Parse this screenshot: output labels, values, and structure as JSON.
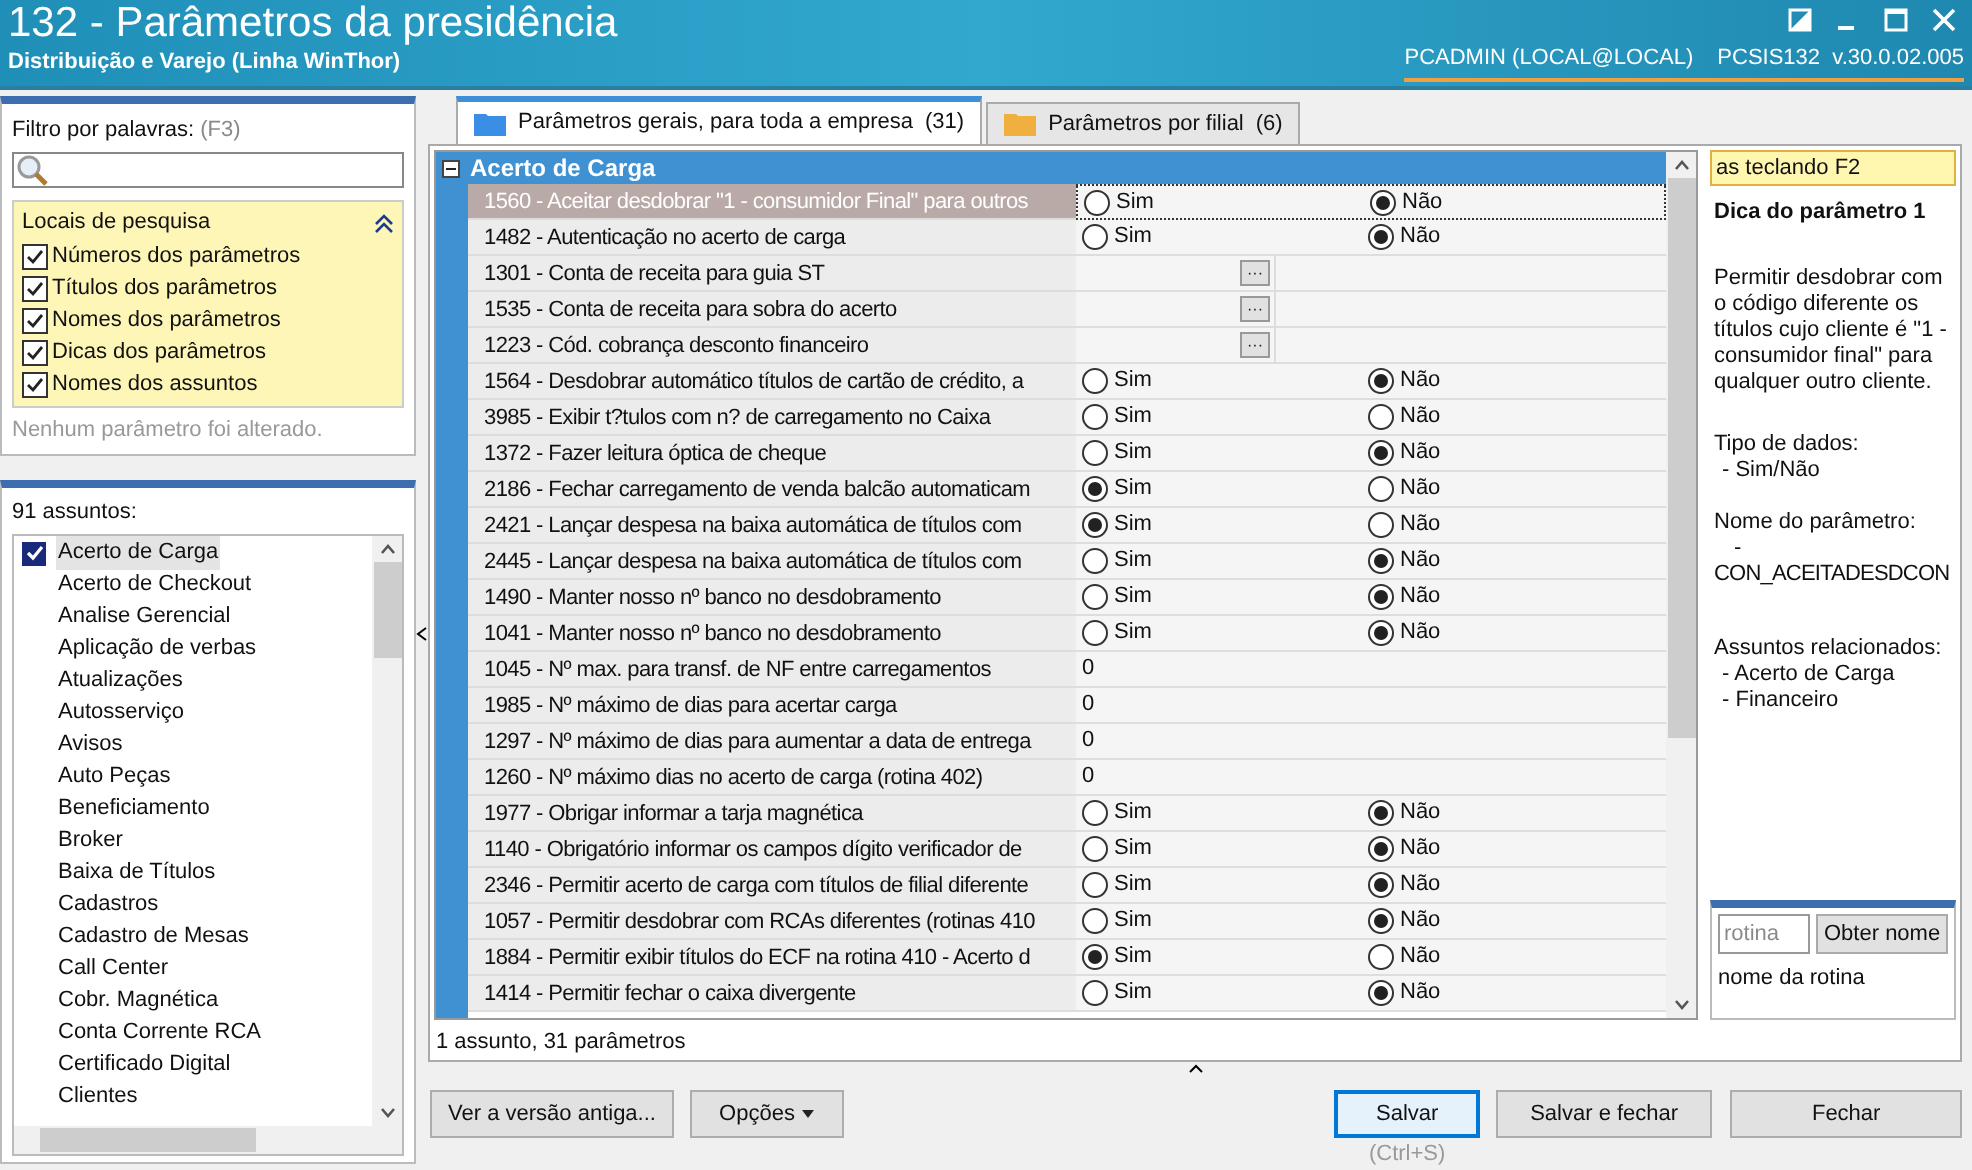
{
  "window": {
    "title": "132 - Parâmetros da presidência",
    "subtitle": "Distribuição e Varejo (Linha WinThor)",
    "user": "PCADMIN (LOCAL@LOCAL)",
    "version": "PCSIS132  v.30.0.02.005"
  },
  "filter": {
    "label": "Filtro por palavras:",
    "shortcut": "(F3)",
    "locations_title": "Locais de pesquisa",
    "locations": [
      {
        "label": "Números dos parâmetros",
        "checked": true
      },
      {
        "label": "Títulos dos parâmetros",
        "checked": true
      },
      {
        "label": "Nomes dos parâmetros",
        "checked": true
      },
      {
        "label": "Dicas dos parâmetros",
        "checked": true
      },
      {
        "label": "Nomes dos assuntos",
        "checked": true
      }
    ],
    "status": "Nenhum parâmetro foi alterado."
  },
  "subjects": {
    "count_label": "91 assuntos:",
    "items": [
      {
        "label": "Acerto de Carga",
        "checked": true
      },
      {
        "label": "Acerto de Checkout",
        "checked": false
      },
      {
        "label": "Analise Gerencial",
        "checked": false
      },
      {
        "label": "Aplicação de verbas",
        "checked": false
      },
      {
        "label": "Atualizações",
        "checked": false
      },
      {
        "label": "Autosserviço",
        "checked": false
      },
      {
        "label": "Avisos",
        "checked": false
      },
      {
        "label": "Auto Peças",
        "checked": false
      },
      {
        "label": "Beneficiamento",
        "checked": false
      },
      {
        "label": "Broker",
        "checked": false
      },
      {
        "label": "Baixa de Títulos",
        "checked": false
      },
      {
        "label": "Cadastros",
        "checked": false
      },
      {
        "label": "Cadastro de Mesas",
        "checked": false
      },
      {
        "label": "Call Center",
        "checked": false
      },
      {
        "label": "Cobr. Magnética",
        "checked": false
      },
      {
        "label": "Conta Corrente RCA",
        "checked": false
      },
      {
        "label": "Certificado Digital",
        "checked": false
      },
      {
        "label": "Clientes",
        "checked": false
      }
    ]
  },
  "tabs": [
    {
      "label": "Parâmetros gerais, para toda a empresa",
      "count": "(31)",
      "selected": true
    },
    {
      "label": "Parâmetros por filial",
      "count": "(6)",
      "selected": false
    }
  ],
  "group": {
    "title": "Acerto de Carga",
    "expanded": true
  },
  "parameters": [
    {
      "label": "1560 - Aceitar desdobrar \"1 - consumidor Final\" para outros",
      "kind": "yesno",
      "yes": "Sim",
      "no": "Não",
      "yes_selected": false,
      "no_selected": true,
      "selected": true
    },
    {
      "label": "1482 - Autenticação no acerto de carga",
      "kind": "yesno",
      "yes": "Sim",
      "no": "Não",
      "yes_selected": false,
      "no_selected": true,
      "selected": false
    },
    {
      "label": "1301 - Conta de receita para guia ST",
      "kind": "lookup",
      "button": "···",
      "selected": false
    },
    {
      "label": "1535 - Conta de receita para sobra do acerto",
      "kind": "lookup",
      "button": "···",
      "selected": false
    },
    {
      "label": "1223 - Cód. cobrança desconto financeiro",
      "kind": "lookup",
      "button": "···",
      "selected": false
    },
    {
      "label": "1564 - Desdobrar automático títulos de cartão de crédito, a",
      "kind": "yesno",
      "yes": "Sim",
      "no": "Não",
      "yes_selected": false,
      "no_selected": true,
      "selected": false
    },
    {
      "label": "3985 - Exibir t?tulos com n? de carregamento no Caixa",
      "kind": "yesno",
      "yes": "Sim",
      "no": "Não",
      "yes_selected": false,
      "no_selected": false,
      "selected": false
    },
    {
      "label": "1372 - Fazer leitura óptica de cheque",
      "kind": "yesno",
      "yes": "Sim",
      "no": "Não",
      "yes_selected": false,
      "no_selected": true,
      "selected": false
    },
    {
      "label": "2186 - Fechar carregamento de venda balcão automaticam",
      "kind": "yesno",
      "yes": "Sim",
      "no": "Não",
      "yes_selected": true,
      "no_selected": false,
      "selected": false
    },
    {
      "label": "2421 - Lançar despesa na baixa automática de títulos com",
      "kind": "yesno",
      "yes": "Sim",
      "no": "Não",
      "yes_selected": true,
      "no_selected": false,
      "selected": false
    },
    {
      "label": "2445 - Lançar despesa na baixa automática de títulos com",
      "kind": "yesno",
      "yes": "Sim",
      "no": "Não",
      "yes_selected": false,
      "no_selected": true,
      "selected": false
    },
    {
      "label": "1490 - Manter nosso nº banco no desdobramento",
      "kind": "yesno",
      "yes": "Sim",
      "no": "Não",
      "yes_selected": false,
      "no_selected": true,
      "selected": false
    },
    {
      "label": "1041 - Manter nosso nº banco no desdobramento",
      "kind": "yesno",
      "yes": "Sim",
      "no": "Não",
      "yes_selected": false,
      "no_selected": true,
      "selected": false
    },
    {
      "label": "1045 - Nº max. para transf. de NF entre carregamentos",
      "kind": "number",
      "value": "0",
      "selected": false
    },
    {
      "label": "1985 - Nº máximo de dias para acertar carga",
      "kind": "number",
      "value": "0",
      "selected": false
    },
    {
      "label": "1297 - Nº máximo de dias para aumentar a data de entrega",
      "kind": "number",
      "value": "0",
      "selected": false
    },
    {
      "label": "1260 - Nº máximo dias no acerto de carga (rotina 402)",
      "kind": "number",
      "value": "0",
      "selected": false
    },
    {
      "label": "1977 - Obrigar informar a tarja magnética",
      "kind": "yesno",
      "yes": "Sim",
      "no": "Não",
      "yes_selected": false,
      "no_selected": true,
      "selected": false
    },
    {
      "label": "1140 - Obrigatório informar os campos dígito verificador de",
      "kind": "yesno",
      "yes": "Sim",
      "no": "Não",
      "yes_selected": false,
      "no_selected": true,
      "selected": false
    },
    {
      "label": "2346 - Permitir acerto de carga com títulos de filial diferente",
      "kind": "yesno",
      "yes": "Sim",
      "no": "Não",
      "yes_selected": false,
      "no_selected": true,
      "selected": false
    },
    {
      "label": "1057 - Permitir desdobrar com RCAs diferentes (rotinas 410",
      "kind": "yesno",
      "yes": "Sim",
      "no": "Não",
      "yes_selected": false,
      "no_selected": true,
      "selected": false
    },
    {
      "label": "1884 - Permitir exibir títulos do ECF na rotina 410 - Acerto d",
      "kind": "yesno",
      "yes": "Sim",
      "no": "Não",
      "yes_selected": true,
      "no_selected": false,
      "selected": false
    },
    {
      "label": "1414 - Permitir fechar o caixa divergente",
      "kind": "yesno",
      "yes": "Sim",
      "no": "Não",
      "yes_selected": false,
      "no_selected": true,
      "selected": false
    }
  ],
  "summary": "1 assunto, 31 parâmetros",
  "hint_panel": {
    "banner": "as teclando F2",
    "title": "Dica do parâmetro 1",
    "description": "Permitir desdobrar com o código diferente os títulos cujo cliente é \"1 - consumidor final\" para qualquer outro cliente.",
    "type_label": "Tipo de dados:",
    "type_value": "- Sim/Não",
    "name_label": "Nome do parâmetro:",
    "name_dash": "-",
    "name_value": "CON_ACEITADESDCON",
    "subjects_label": "Assuntos relacionados:",
    "subjects": [
      "- Acerto de Carga",
      "- Financeiro"
    ]
  },
  "routine": {
    "placeholder": "rotina",
    "button": "Obter nome",
    "result": "nome da rotina"
  },
  "buttons": {
    "old_version": "Ver a versão antiga...",
    "options": "Opções",
    "save": "Salvar",
    "save_shortcut": "(Ctrl+S)",
    "save_close": "Salvar e fechar",
    "close": "Fechar"
  }
}
